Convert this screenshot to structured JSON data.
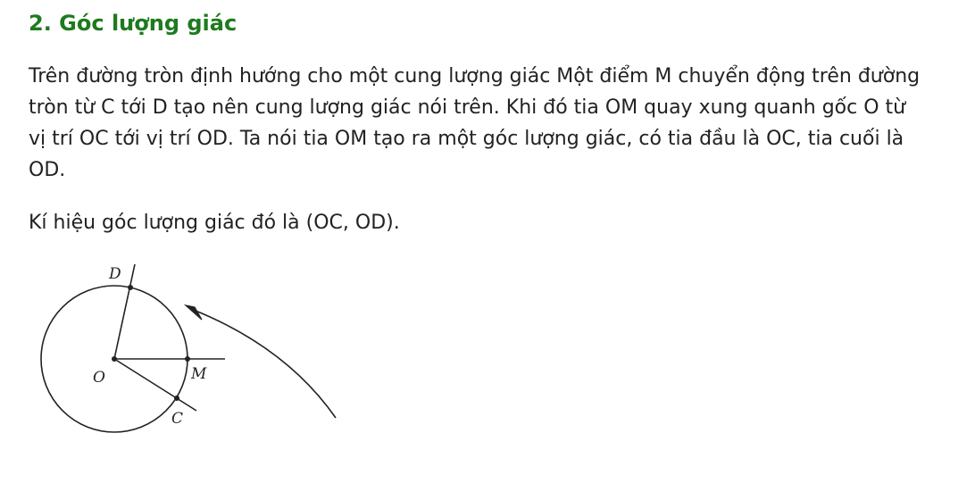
{
  "section": {
    "heading": "2. Góc lượng giác"
  },
  "paragraphs": {
    "definition": "Trên đường tròn định hướng cho một cung lượng giác Một điểm M chuyển động trên đường tròn từ C tới D tạo nên cung lượng giác nói trên. Khi đó tia OM quay xung quanh gốc O từ vị trí OC tới vị trí OD. Ta nói tia OM tạo ra một góc lượng giác, có tia đầu là OC, tia cuối là OD.",
    "notation": "Kí hiệu góc lượng giác đó là (OC, OD)."
  },
  "figure": {
    "labels": {
      "D": "D",
      "O": "O",
      "M": "M",
      "C": "C"
    },
    "colors": {
      "stroke": "#222222"
    }
  }
}
